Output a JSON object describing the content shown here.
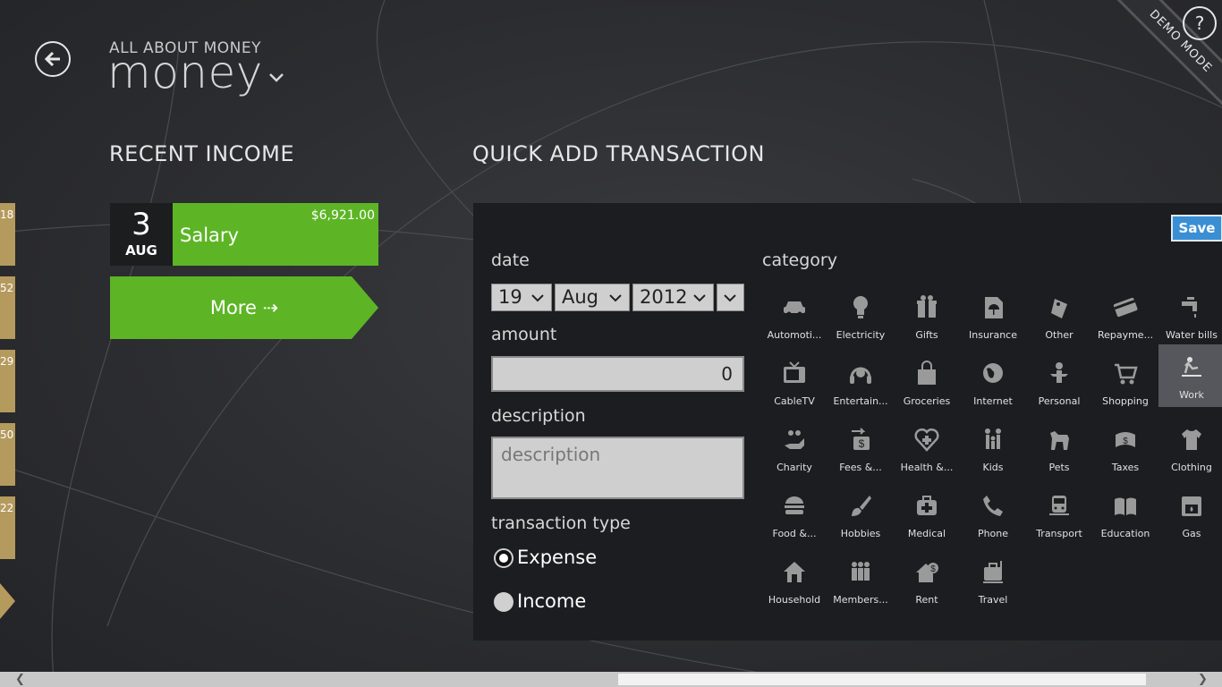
{
  "header": {
    "subtitle": "ALL ABOUT MONEY",
    "title": "money",
    "help": "?",
    "demo_ribbon": "DEMO MODE"
  },
  "edge_tiles": [
    "18",
    "52",
    "29",
    "50",
    "22"
  ],
  "recent_income": {
    "heading": "RECENT INCOME",
    "item": {
      "day": "3",
      "month": "AUG",
      "name": "Salary",
      "amount": "$6,921.00"
    },
    "more": "More ⇢"
  },
  "quick_add": {
    "heading": "QUICK ADD TRANSACTION",
    "save": "Save",
    "date_label": "date",
    "date": {
      "day": "19",
      "month": "Aug",
      "year": "2012"
    },
    "amount_label": "amount",
    "amount_value": "0",
    "description_label": "description",
    "description_placeholder": "description",
    "type_label": "transaction type",
    "type_options": [
      "Expense",
      "Income"
    ],
    "type_selected": "Expense",
    "category_label": "category",
    "categories": [
      {
        "label": "Automoti...",
        "icon": "car-icon"
      },
      {
        "label": "Electricity",
        "icon": "lightbulb-icon"
      },
      {
        "label": "Gifts",
        "icon": "gift-icon"
      },
      {
        "label": "Insurance",
        "icon": "insurance-icon"
      },
      {
        "label": "Other",
        "icon": "tag-icon"
      },
      {
        "label": "Repayme...",
        "icon": "credit-card-icon"
      },
      {
        "label": "Water bills",
        "icon": "faucet-icon"
      },
      {
        "label": "CableTV",
        "icon": "tv-icon"
      },
      {
        "label": "Entertain...",
        "icon": "headphones-icon"
      },
      {
        "label": "Groceries",
        "icon": "bag-icon"
      },
      {
        "label": "Internet",
        "icon": "globe-icon"
      },
      {
        "label": "Personal",
        "icon": "person-icon"
      },
      {
        "label": "Shopping",
        "icon": "cart-icon"
      },
      {
        "label": "Work",
        "icon": "work-icon"
      },
      {
        "label": "Charity",
        "icon": "charity-icon"
      },
      {
        "label": "Fees &...",
        "icon": "fees-icon"
      },
      {
        "label": "Health &...",
        "icon": "heart-icon"
      },
      {
        "label": "Kids",
        "icon": "kids-icon"
      },
      {
        "label": "Pets",
        "icon": "pet-icon"
      },
      {
        "label": "Taxes",
        "icon": "taxes-icon"
      },
      {
        "label": "Clothing",
        "icon": "shirt-icon"
      },
      {
        "label": "Food &...",
        "icon": "burger-icon"
      },
      {
        "label": "Hobbies",
        "icon": "paintbrush-icon"
      },
      {
        "label": "Medical",
        "icon": "medical-icon"
      },
      {
        "label": "Phone",
        "icon": "phone-icon"
      },
      {
        "label": "Transport",
        "icon": "train-icon"
      },
      {
        "label": "Education",
        "icon": "book-icon"
      },
      {
        "label": "Gas",
        "icon": "gas-icon"
      },
      {
        "label": "Household",
        "icon": "house-icon"
      },
      {
        "label": "Members...",
        "icon": "members-icon"
      },
      {
        "label": "Rent",
        "icon": "rent-icon"
      },
      {
        "label": "Travel",
        "icon": "luggage-icon"
      }
    ],
    "selected_category": "Work"
  },
  "colors": {
    "income_green": "#5db526",
    "edge_tile_gold": "#b59a5e",
    "save_blue": "#3a8fd4",
    "panel_bg": "#1c1d20"
  }
}
